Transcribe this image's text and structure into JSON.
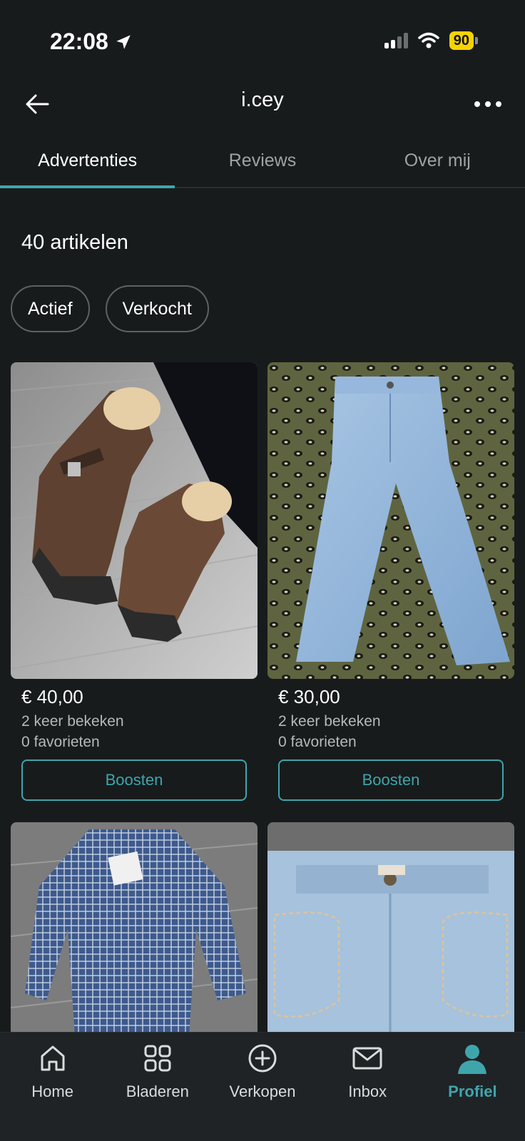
{
  "status": {
    "time": "22:08",
    "battery": "90"
  },
  "header": {
    "title": "i.cey"
  },
  "tabs": [
    {
      "label": "Advertenties",
      "active": true
    },
    {
      "label": "Reviews",
      "active": false
    },
    {
      "label": "Over mij",
      "active": false
    }
  ],
  "listing": {
    "count_label": "40 artikelen",
    "filters": [
      "Actief",
      "Verkocht"
    ],
    "items": [
      {
        "image": "brown-boots-photo",
        "price": "€ 40,00",
        "views": "2 keer bekeken",
        "favorites": "0 favorieten",
        "action": "Boosten"
      },
      {
        "image": "light-blue-flared-jeans-photo",
        "price": "€ 30,00",
        "views": "2 keer bekeken",
        "favorites": "0 favorieten",
        "action": "Boosten"
      },
      {
        "image": "blue-checkered-shirt-photo"
      },
      {
        "image": "light-denim-jeans-photo"
      }
    ]
  },
  "nav": [
    {
      "label": "Home",
      "icon": "home-icon",
      "active": false
    },
    {
      "label": "Bladeren",
      "icon": "grid-icon",
      "active": false
    },
    {
      "label": "Verkopen",
      "icon": "plus-circle-icon",
      "active": false
    },
    {
      "label": "Inbox",
      "icon": "mail-icon",
      "active": false
    },
    {
      "label": "Profiel",
      "icon": "profile-icon",
      "active": true
    }
  ],
  "colors": {
    "accent": "#3fa5ac",
    "background": "#181b1c",
    "battery": "#f5d300"
  }
}
